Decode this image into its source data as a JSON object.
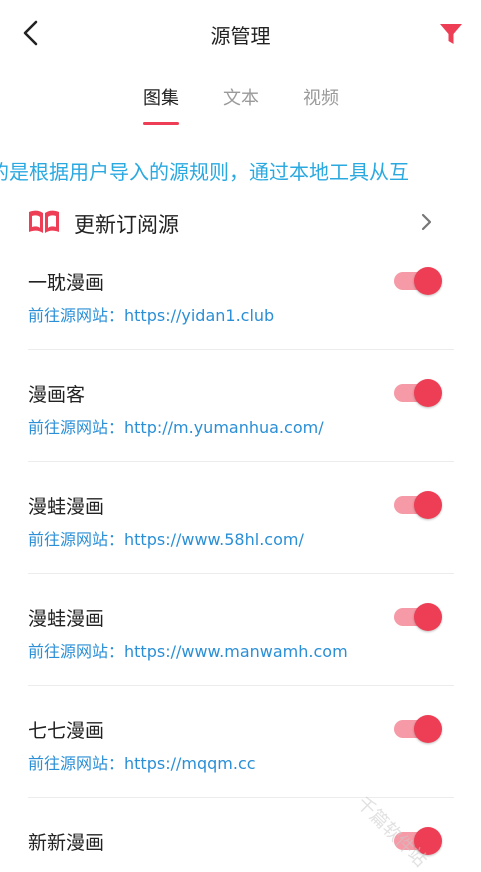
{
  "header": {
    "title": "源管理",
    "back_icon": "chevron-left-icon",
    "filter_icon": "filter-icon",
    "accent_color": "#ee3e55"
  },
  "tabs": [
    {
      "label": "图集",
      "active": true
    },
    {
      "label": "文本",
      "active": false
    },
    {
      "label": "视频",
      "active": false
    }
  ],
  "marquee": {
    "text": "的是根据用户导入的源规则，通过本地工具从互"
  },
  "subscribe": {
    "label": "更新订阅源",
    "icon": "book-icon"
  },
  "link_prefix": "前往源网站：",
  "sources": [
    {
      "name": "一耽漫画",
      "url": "https://yidan1.club",
      "enabled": true
    },
    {
      "name": "漫画客",
      "url": "http://m.yumanhua.com/",
      "enabled": true
    },
    {
      "name": "漫蛙漫画",
      "url": "https://www.58hl.com/",
      "enabled": true
    },
    {
      "name": "漫蛙漫画",
      "url": "https://www.manwamh.com",
      "enabled": true
    },
    {
      "name": "七七漫画",
      "url": "https://mqqm.cc",
      "enabled": true
    },
    {
      "name": "新新漫画",
      "url": "",
      "enabled": true
    }
  ],
  "watermark": "千篇软件站"
}
